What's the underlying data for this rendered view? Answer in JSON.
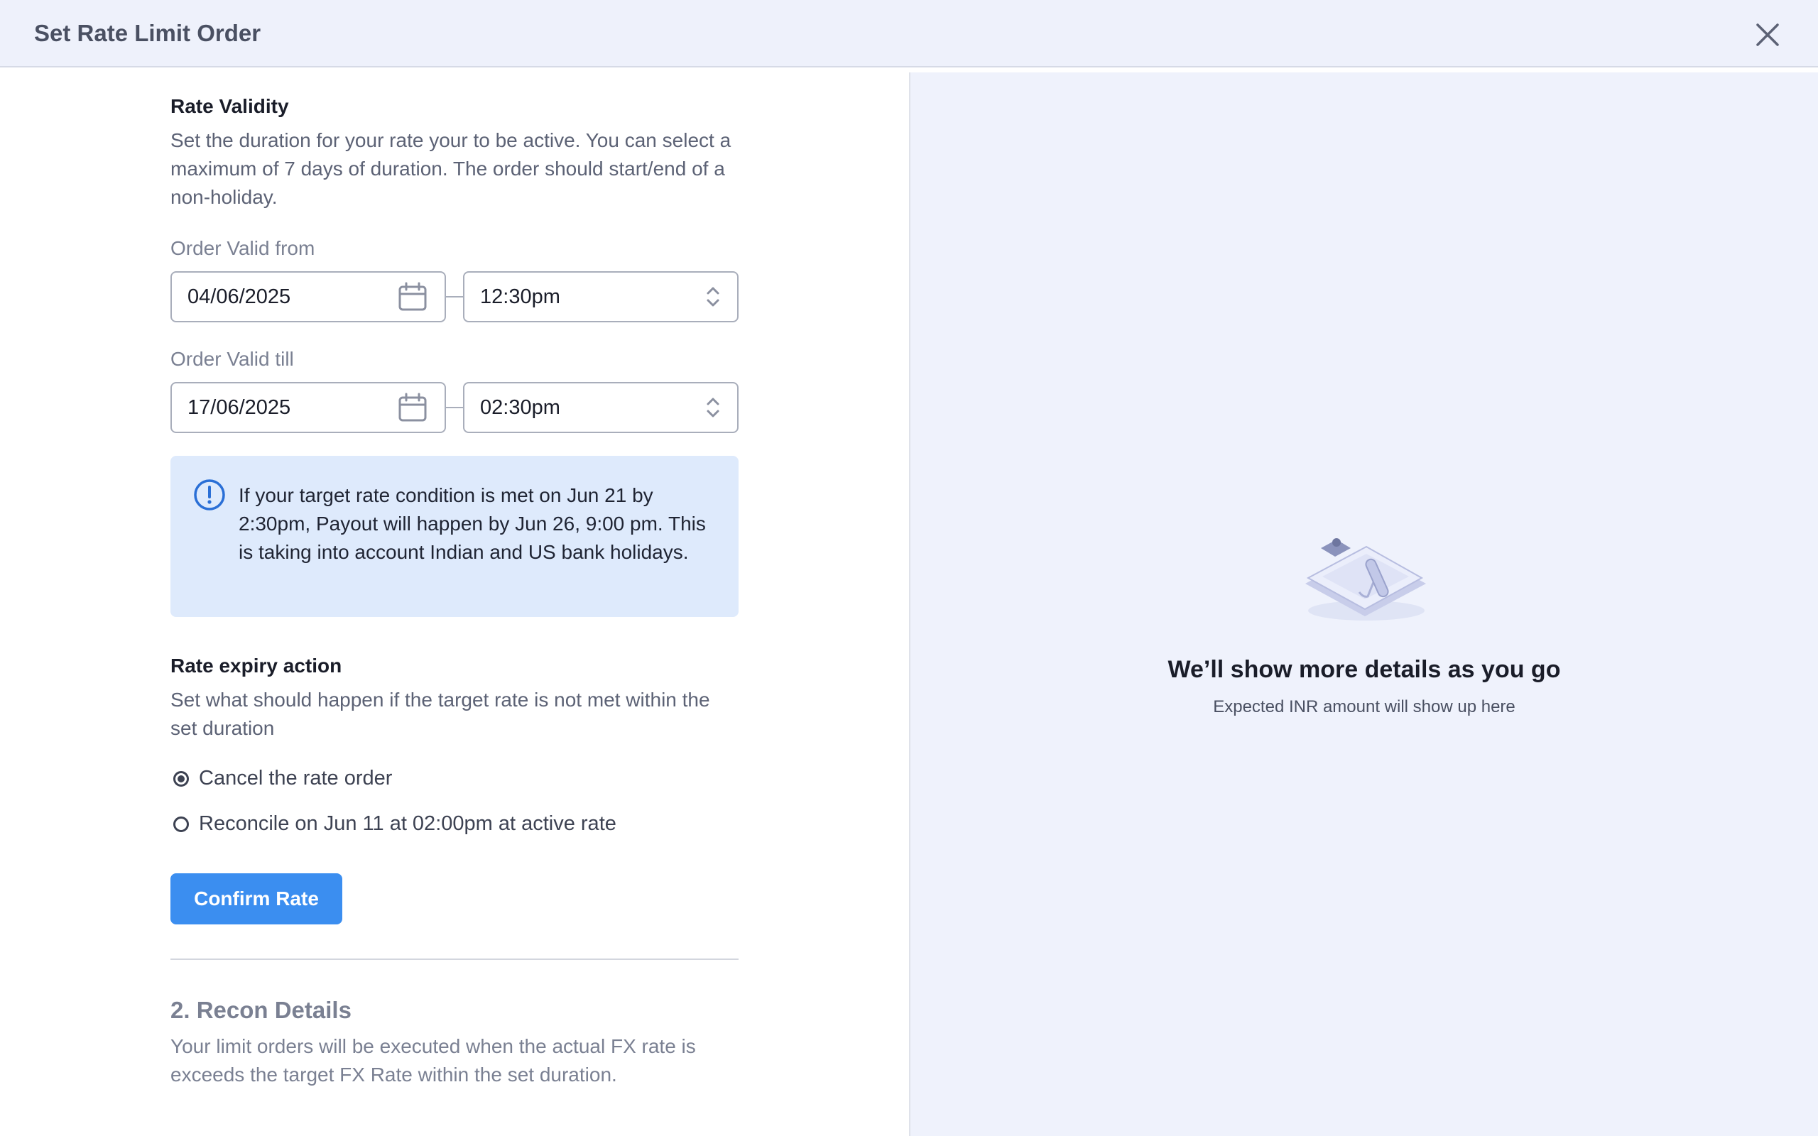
{
  "header": {
    "title": "Set Rate Limit Order"
  },
  "rate_validity": {
    "title": "Rate Validity",
    "description": "Set the duration for your rate your to be active. You can select a maximum of 7 days of duration. The order should start/end of a non-holiday."
  },
  "valid_from": {
    "label": "Order Valid from",
    "date": "04/06/2025",
    "time": "12:30pm"
  },
  "valid_till": {
    "label": "Order Valid till",
    "date": "17/06/2025",
    "time": "02:30pm"
  },
  "info": {
    "text": "If your target rate condition is met on Jun 21 by 2:30pm, Payout will happen by Jun 26, 9:00 pm. This is taking into account Indian and US bank holidays."
  },
  "expiry": {
    "title": "Rate expiry action",
    "description": "Set what should happen if the target rate is not met within the set duration",
    "options": [
      {
        "label": "Cancel the rate order",
        "selected": true
      },
      {
        "label": "Reconcile on Jun 11 at 02:00pm at active rate",
        "selected": false
      }
    ]
  },
  "confirm_label": "Confirm Rate",
  "recon": {
    "title": "2. Recon Details",
    "description": "Your limit orders will be executed when the actual FX rate is exceeds the target FX Rate within the set duration."
  },
  "empty_state": {
    "title": "We’ll show more details as you go",
    "subtitle": "Expected INR amount will show up here"
  },
  "colors": {
    "accent": "#3b8ef0",
    "info_bg": "#deeafc",
    "right_bg": "#eff2fc"
  }
}
